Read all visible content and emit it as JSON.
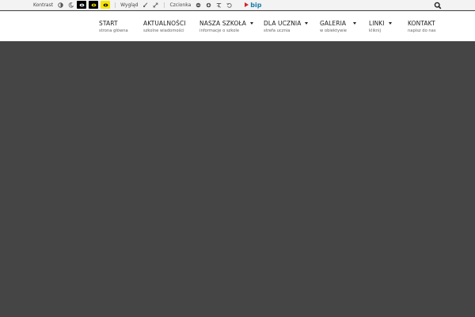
{
  "toolbar": {
    "contrast_label": "Kontrast",
    "appearance_label": "Wygląd",
    "font_label": "Czcionka",
    "bip_text": "bip"
  },
  "nav": {
    "items": [
      {
        "title": "START",
        "subtitle": "strona główna",
        "dropdown": false
      },
      {
        "title": "AKTUALNOŚCI",
        "subtitle": "szkolne wiadomości",
        "dropdown": false
      },
      {
        "title": "NASZA SZKOŁA",
        "subtitle": "informacje o szkole",
        "dropdown": true
      },
      {
        "title": "DLA UCZNIA",
        "subtitle": "strefa ucznia",
        "dropdown": true
      },
      {
        "title": "GALERIA",
        "subtitle": "w obiektywie",
        "dropdown": true
      },
      {
        "title": "LINKI",
        "subtitle": "kliknij",
        "dropdown": true
      },
      {
        "title": "KONTAKT",
        "subtitle": "napisz do nas",
        "dropdown": false
      }
    ]
  },
  "colors": {
    "background": "#454545",
    "nav_bg": "#ffffff",
    "toolbar_bg": "#f3f3f3",
    "yellow": "#f5e400",
    "bip_blue": "#1a7fa8",
    "bip_red": "#d0252b"
  }
}
